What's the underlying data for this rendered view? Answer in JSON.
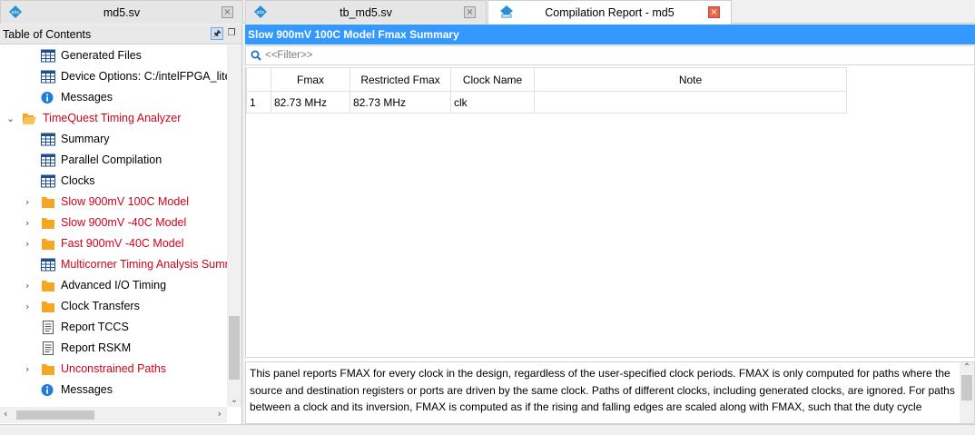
{
  "tabs": [
    {
      "label": "md5.sv",
      "close": "×"
    },
    {
      "label": "tb_md5.sv",
      "close": "×"
    },
    {
      "label": "Compilation Report - md5",
      "close": "×"
    }
  ],
  "toc": {
    "title": "Table of Contents",
    "pin_glyph": "🖈",
    "restore_glyph": "❐",
    "items": [
      {
        "label": "Generated Files",
        "icon": "table-icon"
      },
      {
        "label": "Device Options: C:/intelFPGA_lite/",
        "icon": "table-icon"
      },
      {
        "label": "Messages",
        "icon": "info-icon"
      },
      {
        "label": "TimeQuest Timing Analyzer",
        "icon": "folder-open-icon",
        "expand": "⌄"
      },
      {
        "label": "Summary",
        "icon": "table-icon"
      },
      {
        "label": "Parallel Compilation",
        "icon": "table-icon"
      },
      {
        "label": "Clocks",
        "icon": "table-icon"
      },
      {
        "label": "Slow 900mV 100C Model",
        "icon": "folder-icon",
        "expand": "›"
      },
      {
        "label": "Slow 900mV -40C Model",
        "icon": "folder-icon",
        "expand": "›"
      },
      {
        "label": "Fast 900mV -40C Model",
        "icon": "folder-icon",
        "expand": "›"
      },
      {
        "label": "Multicorner Timing Analysis Summ",
        "icon": "table-icon"
      },
      {
        "label": "Advanced I/O Timing",
        "icon": "folder-icon",
        "expand": "›"
      },
      {
        "label": "Clock Transfers",
        "icon": "folder-icon",
        "expand": "›"
      },
      {
        "label": "Report TCCS",
        "icon": "text-report-icon"
      },
      {
        "label": "Report RSKM",
        "icon": "text-report-icon"
      },
      {
        "label": "Unconstrained Paths",
        "icon": "folder-icon",
        "expand": "›"
      },
      {
        "label": "Messages",
        "icon": "info-icon"
      }
    ],
    "scroll": {
      "down": "⌄",
      "left": "‹",
      "right": "›"
    }
  },
  "report": {
    "title": "Slow 900mV 100C Model Fmax Summary",
    "filter_placeholder": "<<Filter>>",
    "columns": [
      "",
      "Fmax",
      "Restricted Fmax",
      "Clock Name",
      "Note"
    ],
    "rows": [
      [
        "1",
        "82.73 MHz",
        "82.73 MHz",
        "clk",
        ""
      ]
    ],
    "notes": "This panel reports FMAX for every clock in the design, regardless of the user-specified clock periods.  FMAX is only computed for paths where the source and destination registers or ports are driven by the same clock.  Paths of different clocks, including generated clocks, are ignored.  For paths between a clock and its inversion, FMAX is computed as if the rising and falling edges are scaled along with FMAX, such that the duty cycle",
    "notes_scroll_up": "⌃"
  },
  "colors": {
    "accent": "#3399ff",
    "red_text": "#d0021b",
    "folder": "#f5a623",
    "table_icon": "#1f4e8c"
  }
}
